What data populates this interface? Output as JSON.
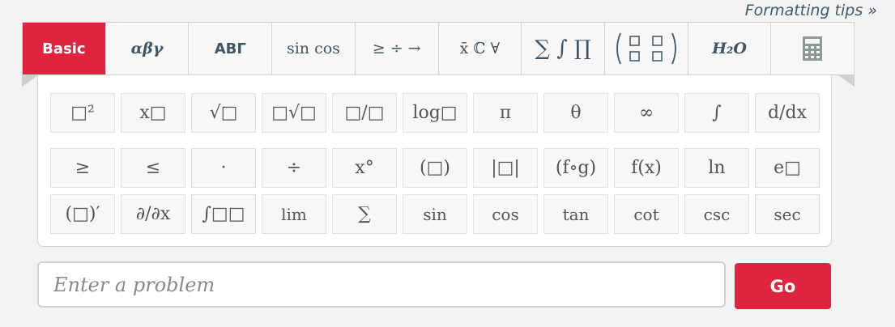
{
  "header": {
    "tips_label": "Formatting tips »"
  },
  "tabs": [
    {
      "label": "Basic",
      "active": true
    },
    {
      "label": "αβγ"
    },
    {
      "label": "ΑΒΓ"
    },
    {
      "label": "sin cos"
    },
    {
      "label": "≥ ÷ →"
    },
    {
      "label": "x̄ ℂ ∀"
    },
    {
      "label": "∑ ∫ ∏"
    },
    {
      "label": "matrix"
    },
    {
      "label": "H₂O"
    },
    {
      "label": "calculator"
    }
  ],
  "keypad": {
    "row1": [
      "□²",
      "x□",
      "√□",
      "□√□",
      "□/□",
      "log□",
      "π",
      "θ",
      "∞",
      "∫",
      "d/dx"
    ],
    "row2": [
      "≥",
      "≤",
      "·",
      "÷",
      "x°",
      "(□)",
      "|□|",
      "(f∘g)",
      "f(x)",
      "ln",
      "e□"
    ],
    "row3": [
      "(□)′",
      "∂/∂x",
      "∫□□",
      "lim",
      "∑",
      "sin",
      "cos",
      "tan",
      "cot",
      "csc",
      "sec"
    ]
  },
  "input": {
    "placeholder": "Enter a problem",
    "value": ""
  },
  "go_label": "Go",
  "colors": {
    "accent": "#df2440",
    "tab_text": "#3e5566",
    "key_bg": "#f7f7f7"
  }
}
